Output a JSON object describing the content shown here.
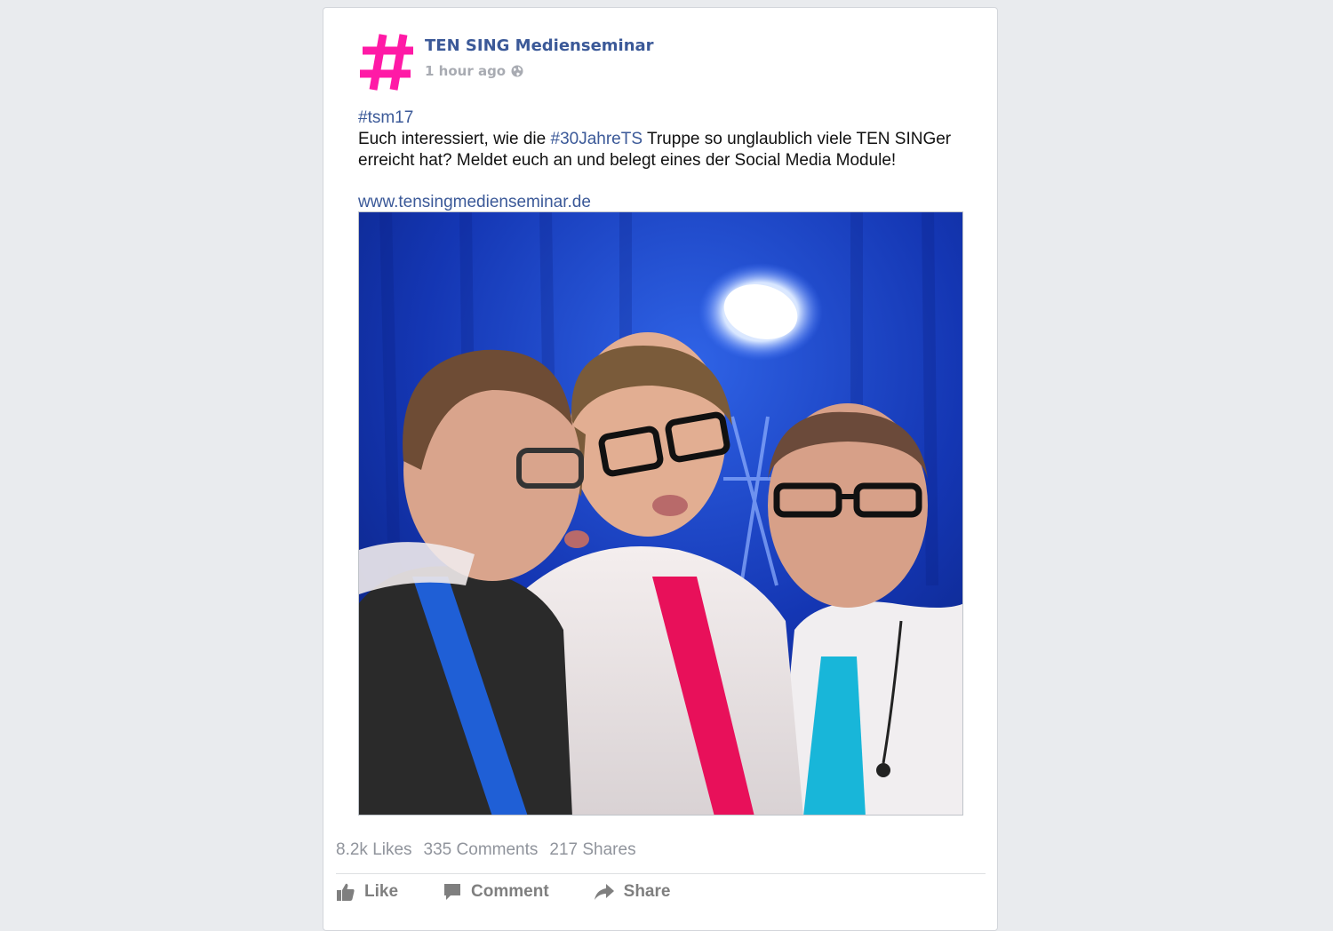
{
  "post": {
    "page_name": "TEN SING Medienseminar",
    "timestamp": "1 hour ago",
    "privacy_icon": "globe-icon",
    "logo_icon": "hashtag-icon",
    "logo_color": "#ff1aa6",
    "text": {
      "hashtag_line": "#tsm17",
      "line_prefix": "Euch interessiert, wie die ",
      "inline_hashtag": "#30JahreTS",
      "line_suffix": " Truppe so unglaublich viele TEN SINGer erreicht hat? Meldet euch an und belegt eines der Social Media Module!",
      "url": "www.tensingmedienseminar.de"
    },
    "stats": {
      "likes": "8.2k Likes",
      "comments": "335 Comments",
      "shares": "217 Shares"
    },
    "actions": {
      "like": "Like",
      "comment": "Comment",
      "share": "Share"
    }
  },
  "colors": {
    "link": "#3b5998",
    "background": "#e9ebee"
  }
}
